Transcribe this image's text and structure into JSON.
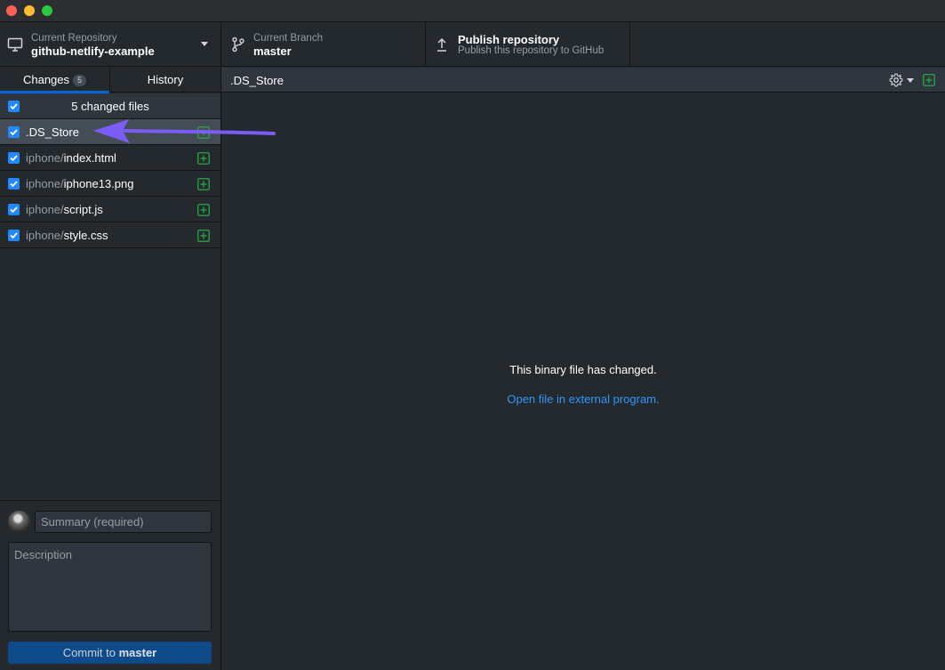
{
  "toolbar": {
    "repository": {
      "small_label": "Current Repository",
      "name": "github-netlify-example"
    },
    "branch": {
      "small_label": "Current Branch",
      "name": "master"
    },
    "publish": {
      "title": "Publish repository",
      "subtitle": "Publish this repository to GitHub"
    }
  },
  "sidebar": {
    "tabs": [
      {
        "label": "Changes",
        "badge": "5",
        "active": true
      },
      {
        "label": "History",
        "active": false
      }
    ],
    "changed_files_label": "5 changed files",
    "files": [
      {
        "dir": "",
        "name": ".DS_Store",
        "checked": true,
        "selected": true,
        "status": "added"
      },
      {
        "dir": "iphone/",
        "name": "index.html",
        "checked": true,
        "selected": false,
        "status": "added"
      },
      {
        "dir": "iphone/",
        "name": "iphone13.png",
        "checked": true,
        "selected": false,
        "status": "added"
      },
      {
        "dir": "iphone/",
        "name": "script.js",
        "checked": true,
        "selected": false,
        "status": "added"
      },
      {
        "dir": "iphone/",
        "name": "style.css",
        "checked": true,
        "selected": false,
        "status": "added"
      }
    ]
  },
  "commit": {
    "summary_placeholder": "Summary (required)",
    "description_placeholder": "Description",
    "button_prefix": "Commit to ",
    "button_branch": "master"
  },
  "main": {
    "file_path": ".DS_Store",
    "binary_message": "This binary file has changed.",
    "open_link": "Open file in external program."
  },
  "colors": {
    "accent": "#0366d6",
    "link": "#2f97ff",
    "added": "#28a745",
    "annotation_arrow": "#7b5cf5"
  },
  "icons": {
    "repo": "computer-icon",
    "branch": "git-branch-icon",
    "publish": "upload-icon",
    "settings": "gear-icon",
    "file_status": "plus-square-icon"
  }
}
